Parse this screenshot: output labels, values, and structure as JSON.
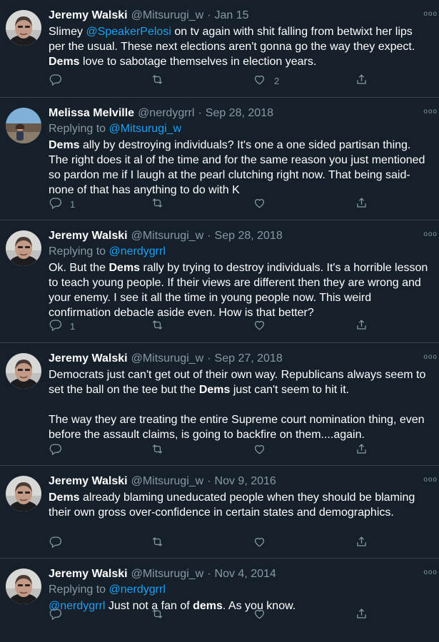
{
  "tweets": [
    {
      "name": "Jeremy Walski",
      "handle": "@Mitsurugi_w",
      "time": "Jan 15",
      "replying_to": null,
      "segments": [
        {
          "t": "Slimey "
        },
        {
          "t": "@SpeakerPelosi",
          "s": "link"
        },
        {
          "t": " on tv again with shit falling from betwixt her lips per the usual. These next elections aren't gonna go the way they expect. "
        },
        {
          "t": "Dems",
          "s": "bold"
        },
        {
          "t": " love to sabotage themselves in election years."
        }
      ],
      "reply_count": "",
      "like_count": "2"
    },
    {
      "name": "Melissa Melville",
      "handle": "@nerdygrrl",
      "time": "Sep 28, 2018",
      "replying_to": "@Mitsurugi_w",
      "segments": [
        {
          "t": "Dems",
          "s": "bold"
        },
        {
          "t": " ally by destroying individuals? It's one a one sided partisan thing. The right does it al of the time and for the same reason you just mentioned so pardon me if I laugh at the pearl clutching right now. That being said-none of that has anything to do with K"
        }
      ],
      "reply_count": "1",
      "like_count": ""
    },
    {
      "name": "Jeremy Walski",
      "handle": "@Mitsurugi_w",
      "time": "Sep 28, 2018",
      "replying_to": "@nerdygrrl",
      "segments": [
        {
          "t": "Ok. But the "
        },
        {
          "t": "Dems",
          "s": "bold"
        },
        {
          "t": " rally by trying to destroy individuals.  It's a horrible lesson to teach young people.  If their views are different then they are wrong and your enemy.  I see it all the time in young people now. This weird confirmation debacle aside even. How is that better?"
        }
      ],
      "reply_count": "1",
      "like_count": ""
    },
    {
      "name": "Jeremy Walski",
      "handle": "@Mitsurugi_w",
      "time": "Sep 27, 2018",
      "replying_to": null,
      "segments": [
        {
          "t": "Democrats just can't get out of their own way.  Republicans always seem to set the ball on the tee but the "
        },
        {
          "t": "Dems",
          "s": "bold"
        },
        {
          "t": " just can't seem to hit it.\n\nThe way they are treating the entire Supreme court nomination thing, even before the assault claims, is going to backfire on them....again."
        }
      ],
      "reply_count": "",
      "like_count": ""
    },
    {
      "name": "Jeremy Walski",
      "handle": "@Mitsurugi_w",
      "time": "Nov 9, 2016",
      "replying_to": null,
      "segments": [
        {
          "t": "Dems",
          "s": "bold"
        },
        {
          "t": " already blaming uneducated people when they should be blaming their own gross over-confidence in certain states and demographics."
        }
      ],
      "reply_count": "",
      "like_count": ""
    },
    {
      "name": "Jeremy Walski",
      "handle": "@Mitsurugi_w",
      "time": "Nov 4, 2014",
      "replying_to": "@nerdygrrl",
      "segments": [
        {
          "t": "@nerdygrrl",
          "s": "link"
        },
        {
          "t": " Just not a fan of "
        },
        {
          "t": "dems",
          "s": "bold"
        },
        {
          "t": ". As you know."
        }
      ],
      "reply_count": "",
      "like_count": ""
    }
  ],
  "labels": {
    "replying_prefix": "Replying to ",
    "dot": "·",
    "more": "ooo"
  },
  "colors": {
    "background": "#15202b",
    "divider": "#38444d",
    "secondary_text": "#8899a6",
    "link": "#1da1f2"
  },
  "icons": {
    "reply": "reply-icon",
    "retweet": "retweet-icon",
    "like": "like-icon",
    "share": "share-icon",
    "more": "more-icon",
    "avatar": "avatar"
  }
}
